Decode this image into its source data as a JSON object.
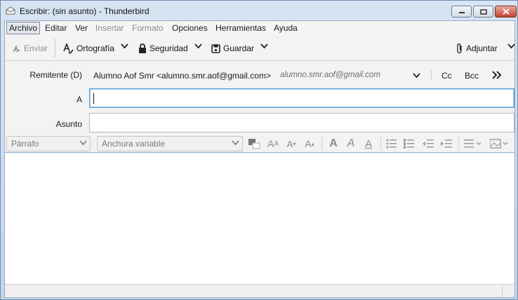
{
  "window": {
    "title": "Escribir: (sin asunto) - Thunderbird"
  },
  "menu": {
    "items": [
      {
        "label": "Archivo",
        "state": "active"
      },
      {
        "label": "Editar",
        "state": "normal"
      },
      {
        "label": "Ver",
        "state": "normal"
      },
      {
        "label": "Insertar",
        "state": "disabled"
      },
      {
        "label": "Formato",
        "state": "disabled"
      },
      {
        "label": "Opciones",
        "state": "normal"
      },
      {
        "label": "Herramientas",
        "state": "normal"
      },
      {
        "label": "Ayuda",
        "state": "normal"
      }
    ]
  },
  "toolbar": {
    "send_label": "Enviar",
    "spelling_label": "Ortografía",
    "security_label": "Seguridad",
    "save_label": "Guardar",
    "attach_label": "Adjuntar"
  },
  "headers": {
    "from_label": "Remitente (D)",
    "from_address": "Alumno Aof Smr <alumno.smr.aof@gmail.com>",
    "from_hint": "alumno.smr.aof@gmail.com",
    "cc_label": "Cc",
    "bcc_label": "Bcc",
    "to_label": "A",
    "to_value": "",
    "subject_label": "Asunto",
    "subject_value": ""
  },
  "format": {
    "paragraph_select": "Párrafo",
    "font_select": "Anchura variable",
    "icons": [
      "text-color-icon",
      "font-size-decrease-icon",
      "font-size-smaller-icon",
      "font-size-larger-icon",
      "bold-icon",
      "italic-icon",
      "underline-icon",
      "bullet-list-icon",
      "numbered-list-icon",
      "outdent-icon",
      "indent-icon",
      "align-icon",
      "insert-icon"
    ]
  },
  "colors": {
    "accent": "#5b9fd6",
    "close_button": "#c2432f"
  }
}
